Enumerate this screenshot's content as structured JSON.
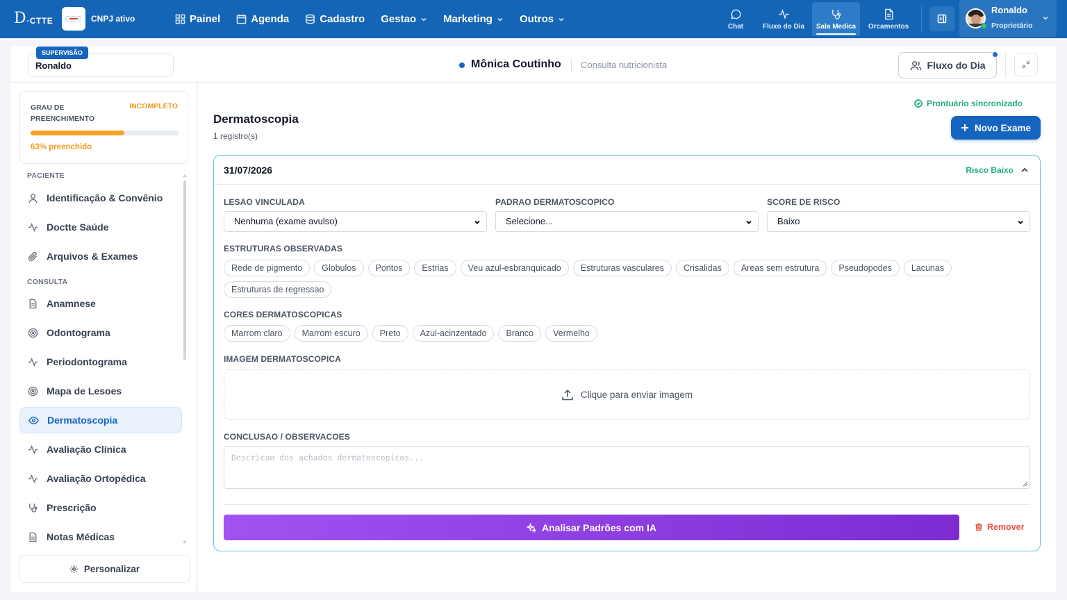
{
  "app": {
    "logo_text": "DOCTTE",
    "cnpj_status": "CNPJ ativo"
  },
  "nav": [
    {
      "label": "Painel",
      "icon": "grid-icon"
    },
    {
      "label": "Agenda",
      "icon": "calendar-icon"
    },
    {
      "label": "Cadastro",
      "icon": "database-icon"
    },
    {
      "label": "Gestao",
      "icon": "chevron-down-icon"
    },
    {
      "label": "Marketing",
      "icon": "chevron-down-icon"
    },
    {
      "label": "Outros",
      "icon": "chevron-down-icon"
    }
  ],
  "quick_nav": [
    {
      "label": "Chat",
      "icon": "chat-icon"
    },
    {
      "label": "Fluxo do Dia",
      "icon": "activity-icon"
    },
    {
      "label": "Sala Medica",
      "icon": "stethoscope-icon",
      "active": true
    },
    {
      "label": "Orcamentos",
      "icon": "document-icon"
    }
  ],
  "user": {
    "name": "Ronaldo",
    "role": "Proprietário"
  },
  "header": {
    "supervision_badge": "SUPERVISÃO",
    "supervisor_name": "Ronaldo",
    "patient_name": "Mônica Coutinho",
    "consultation_type": "Consulta nutricionista",
    "fluxo_button": "Fluxo do Dia"
  },
  "sidebar": {
    "progress": {
      "label": "GRAU DE PREENCHIMENTO",
      "status": "INCOMPLETO",
      "percent": 63,
      "text": "63% preenchido"
    },
    "sections": {
      "patient": "PACIENTE",
      "consult": "CONSULTA"
    },
    "items": [
      {
        "label": "Identificação & Convênio",
        "icon": "user-icon"
      },
      {
        "label": "Doctte Saúde",
        "icon": "activity-icon"
      },
      {
        "label": "Arquivos & Exames",
        "icon": "paperclip-icon"
      },
      {
        "label": "Anamnese",
        "icon": "document-icon"
      },
      {
        "label": "Odontograma",
        "icon": "target-icon"
      },
      {
        "label": "Periodontograma",
        "icon": "activity-icon"
      },
      {
        "label": "Mapa de Lesoes",
        "icon": "target-icon"
      },
      {
        "label": "Dermatoscopia",
        "icon": "eye-icon",
        "active": true
      },
      {
        "label": "Avaliação Clínica",
        "icon": "activity-icon"
      },
      {
        "label": "Avaliação Ortopédica",
        "icon": "activity-icon"
      },
      {
        "label": "Prescrição",
        "icon": "stethoscope-icon"
      },
      {
        "label": "Notas Médicas",
        "icon": "document-icon"
      }
    ],
    "personalize": "Personalizar"
  },
  "main": {
    "sync_status": "Prontuário sincronizado",
    "title": "Dermatoscopia",
    "count": "1 registro(s)",
    "new_button": "Novo Exame",
    "exam": {
      "date": "31/07/2026",
      "risk": "Risco Baixo",
      "fields": {
        "lesion": {
          "label": "LESAO VINCULADA",
          "value": "Nenhuma (exame avulso)"
        },
        "pattern": {
          "label": "PADRAO DERMATOSCOPICO",
          "value": "Selecione..."
        },
        "score": {
          "label": "SCORE DE RISCO",
          "value": "Baixo"
        }
      },
      "structures_label": "ESTRUTURAS OBSERVADAS",
      "structures": [
        "Rede de pigmento",
        "Globulos",
        "Pontos",
        "Estrias",
        "Veu azul-esbranquicado",
        "Estruturas vasculares",
        "Crisalidas",
        "Areas sem estrutura",
        "Pseudopodes",
        "Lacunas",
        "Estruturas de regressao"
      ],
      "colors_label": "CORES DERMATOSCOPICAS",
      "colors": [
        "Marrom claro",
        "Marrom escuro",
        "Preto",
        "Azul-acinzentado",
        "Branco",
        "Vermelho"
      ],
      "image_label": "IMAGEM DERMATOSCOPICA",
      "upload_text": "Clique para enviar imagem",
      "conclusion_label": "CONCLUSAO / OBSERVACOES",
      "conclusion_placeholder": "Descricao dos achados dermatoscopicos...",
      "ai_button": "Analisar Padrões com IA",
      "remove_button": "Remover"
    }
  },
  "colors": {
    "primary": "#1565c0",
    "topbar": "#1565b6",
    "success": "#22b07d",
    "warning": "#f29a1e",
    "danger": "#e8543e",
    "ai_gradient_start": "#a152f0",
    "ai_gradient_end": "#7d2bd1"
  }
}
